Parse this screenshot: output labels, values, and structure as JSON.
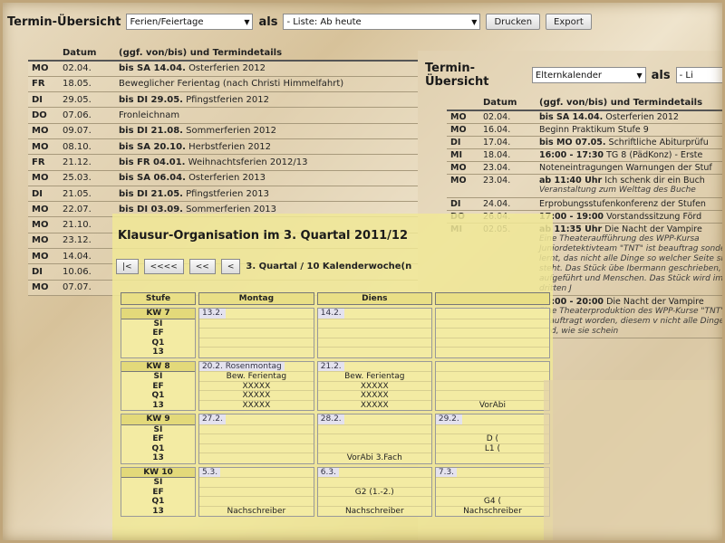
{
  "main": {
    "title": "Termin-Übersicht",
    "category": "Ferien/Feiertage",
    "als": "als",
    "view": "- Liste: Ab heute",
    "print": "Drucken",
    "export": "Export",
    "headers": [
      "",
      "Datum",
      "(ggf. von/bis) und Termindetails"
    ],
    "rows": [
      {
        "d": "MO",
        "date": "02.04.",
        "bold": "bis SA 14.04.",
        "text": "Osterferien 2012"
      },
      {
        "d": "FR",
        "date": "18.05.",
        "bold": "",
        "text": "Beweglicher Ferientag (nach Christi Himmelfahrt)"
      },
      {
        "d": "DI",
        "date": "29.05.",
        "bold": "bis DI 29.05.",
        "text": "Pfingstferien 2012"
      },
      {
        "d": "DO",
        "date": "07.06.",
        "bold": "",
        "text": "Fronleichnam"
      },
      {
        "d": "MO",
        "date": "09.07.",
        "bold": "bis DI 21.08.",
        "text": "Sommerferien 2012"
      },
      {
        "d": "MO",
        "date": "08.10.",
        "bold": "bis SA 20.10.",
        "text": "Herbstferien 2012"
      },
      {
        "d": "FR",
        "date": "21.12.",
        "bold": "bis FR 04.01.",
        "text": "Weihnachtsferien 2012/13"
      },
      {
        "d": "MO",
        "date": "25.03.",
        "bold": "bis SA 06.04.",
        "text": "Osterferien 2013"
      },
      {
        "d": "DI",
        "date": "21.05.",
        "bold": "bis DI 21.05.",
        "text": "Pfingstferien 2013"
      },
      {
        "d": "MO",
        "date": "22.07.",
        "bold": "bis DI 03.09.",
        "text": "Sommerferien 2013"
      },
      {
        "d": "MO",
        "date": "21.10.",
        "bold": "",
        "text": ""
      },
      {
        "d": "MO",
        "date": "23.12.",
        "bold": "",
        "text": ""
      },
      {
        "d": "MO",
        "date": "14.04.",
        "bold": "",
        "text": ""
      },
      {
        "d": "DI",
        "date": "10.06.",
        "bold": "",
        "text": ""
      },
      {
        "d": "MO",
        "date": "07.07.",
        "bold": "",
        "text": ""
      }
    ]
  },
  "second": {
    "title": "Termin-Übersicht",
    "category": "Elternkalender",
    "als": "als",
    "view": "- Li",
    "headers": [
      "",
      "Datum",
      "(ggf. von/bis) und Termindetails"
    ],
    "rows": [
      {
        "d": "MO",
        "date": "02.04.",
        "bold": "bis SA 14.04.",
        "text": "Osterferien 2012",
        "extra": ""
      },
      {
        "d": "MO",
        "date": "16.04.",
        "bold": "",
        "text": "Beginn Praktikum Stufe 9",
        "extra": ""
      },
      {
        "d": "DI",
        "date": "17.04.",
        "bold": "bis MO 07.05.",
        "text": "Schriftliche Abiturprüfu",
        "extra": ""
      },
      {
        "d": "MI",
        "date": "18.04.",
        "bold": "16:00 - 17:30",
        "text": "TG 8 (PädKonz) - Erste",
        "extra": ""
      },
      {
        "d": "MO",
        "date": "23.04.",
        "bold": "",
        "text": "Noteneintragungen Warnungen der Stuf",
        "extra": ""
      },
      {
        "d": "MO",
        "date": "23.04.",
        "bold": "ab 11:40 Uhr",
        "text": "Ich schenk dir ein Buch",
        "extra": "Veranstaltung zum Welttag des Buche"
      },
      {
        "d": "DI",
        "date": "24.04.",
        "bold": "",
        "text": "Erprobungsstufenkonferenz der Stufen",
        "extra": ""
      },
      {
        "d": "DO",
        "date": "26.04.",
        "bold": "17:00 - 19:00",
        "text": "Vorstandssitzung Förd",
        "extra": ""
      },
      {
        "d": "MI",
        "date": "02.05.",
        "bold": "ab 11:35 Uhr",
        "text": "Die Nacht der Vampire",
        "extra": "Eine Theateraufführung des WPP-Kursa Juniordetektivteam \"TNT\" ist beauftrag sondern lernt, das nicht alle Dinge so welcher Seite sie steht. Das Stück übe Ibermann geschrieben, aufgeführt und Menschen. Das Stück wird im dritten J"
      },
      {
        "d": "MI",
        "date": "02.05.",
        "bold": "18:00 - 20:00",
        "text": "Die Nacht der Vampire",
        "extra": "Eine Theaterproduktion des WPP-Kurse \"TNT\" ist beauftragt worden, diesem v nicht alle Dinge so sind, wie sie schein"
      }
    ]
  },
  "klausur": {
    "title": "Klausur-Organisation im 3. Quartal 2011/12",
    "nav": [
      "|<",
      "<<<<",
      "<<",
      "<"
    ],
    "quarter": "3. Quartal / 10 Kalenderwoche(n",
    "col_stufe": "Stufe",
    "days": [
      "Montag",
      "Diens"
    ],
    "weeks": [
      {
        "kw": "KW 7",
        "levels": [
          "SI",
          "EF",
          "Q1",
          "13"
        ],
        "d1": "13.2.",
        "d2": "14.2.",
        "d3": "",
        "d1l": [
          "",
          "",
          "",
          ""
        ],
        "d2l": [
          "",
          "",
          "",
          ""
        ],
        "d3l": [
          "",
          "",
          "",
          ""
        ]
      },
      {
        "kw": "KW 8",
        "levels": [
          "SI",
          "EF",
          "Q1",
          "13"
        ],
        "d1": "20.2. Rosenmontag",
        "d2": "21.2.",
        "d3": "",
        "d1l": [
          "Bew. Ferientag",
          "XXXXX",
          "XXXXX",
          "XXXXX"
        ],
        "d2l": [
          "Bew. Ferientag",
          "XXXXX",
          "XXXXX",
          "XXXXX"
        ],
        "d3l": [
          "",
          "",
          "",
          "VorAbi"
        ]
      },
      {
        "kw": "KW 9",
        "levels": [
          "SI",
          "EF",
          "Q1",
          "13"
        ],
        "d1": "27.2.",
        "d2": "28.2.",
        "d3": "29.2.",
        "d1l": [
          "",
          "",
          "",
          ""
        ],
        "d2l": [
          "",
          "",
          "",
          "VorAbi 3.Fach"
        ],
        "d3l": [
          "",
          "D (",
          "L1 (",
          ""
        ]
      },
      {
        "kw": "KW 10",
        "levels": [
          "SI",
          "EF",
          "Q1",
          "13"
        ],
        "d1": "5.3.",
        "d2": "6.3.",
        "d3": "7.3.",
        "d1l": [
          "",
          "",
          "",
          "Nachschreiber"
        ],
        "d2l": [
          "",
          "G2 (1.-2.)",
          "",
          "Nachschreiber"
        ],
        "d3l": [
          "",
          "",
          "G4 (",
          "Nachschreiber"
        ]
      }
    ]
  }
}
